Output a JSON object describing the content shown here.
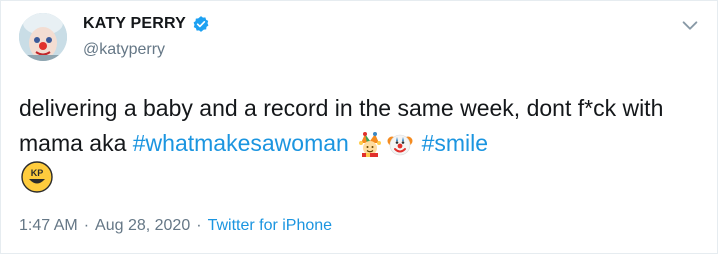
{
  "user": {
    "display_name": "KATY PERRY",
    "handle": "@katyperry",
    "verified_icon": "verified-badge-icon",
    "avatar_icon": "clown-avatar"
  },
  "tweet": {
    "text_part1": "delivering a baby and a record in the same week, dont f*ck with mama aka ",
    "hashtag1": "#whatmakesawoman",
    "emoji1": "jester-face-emoji",
    "emoji2": "clown-face-emoji",
    "hashtag2": "#smile",
    "emoji3": "kp-smiley-emoji",
    "emoji3_text": "KP"
  },
  "meta": {
    "time": "1:47 AM",
    "separator": "·",
    "date": "Aug 28, 2020",
    "source": "Twitter for iPhone"
  },
  "colors": {
    "link": "#1b95e0",
    "secondary": "#657786",
    "primary": "#14171a"
  }
}
